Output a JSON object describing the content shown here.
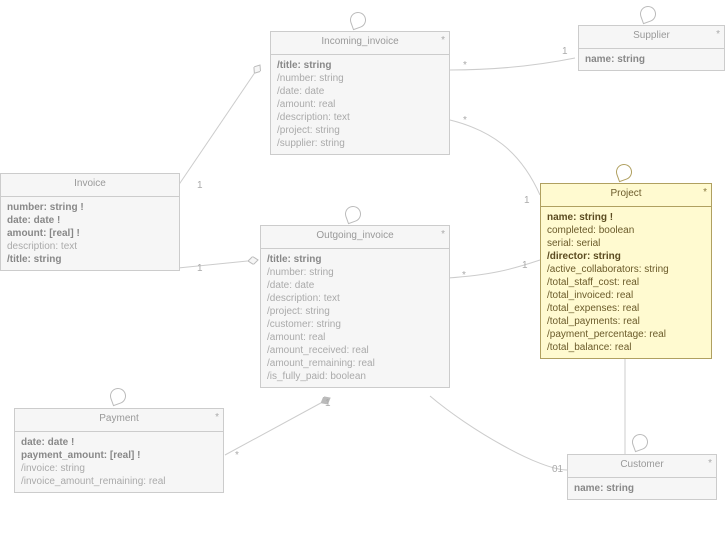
{
  "classes": {
    "invoice": {
      "title": "Invoice",
      "attrs": [
        {
          "t": "number: string !",
          "b": true
        },
        {
          "t": "date: date !",
          "b": true
        },
        {
          "t": "amount: [real] !",
          "b": true
        },
        {
          "t": "description: text",
          "b": false
        },
        {
          "t": "/title: string",
          "b": true
        }
      ]
    },
    "incoming": {
      "title": "Incoming_invoice",
      "mult": "*",
      "attrs": [
        {
          "t": "/title: string",
          "b": true
        },
        {
          "t": "/number: string",
          "b": false
        },
        {
          "t": "/date: date",
          "b": false
        },
        {
          "t": "/amount: real",
          "b": false
        },
        {
          "t": "/description: text",
          "b": false
        },
        {
          "t": "/project: string",
          "b": false
        },
        {
          "t": "/supplier: string",
          "b": false
        }
      ]
    },
    "outgoing": {
      "title": "Outgoing_invoice",
      "mult": "*",
      "attrs": [
        {
          "t": "/title: string",
          "b": true
        },
        {
          "t": "/number: string",
          "b": false
        },
        {
          "t": "/date: date",
          "b": false
        },
        {
          "t": "/description: text",
          "b": false
        },
        {
          "t": "/project: string",
          "b": false
        },
        {
          "t": "/customer: string",
          "b": false
        },
        {
          "t": "/amount: real",
          "b": false
        },
        {
          "t": "/amount_received: real",
          "b": false
        },
        {
          "t": "/amount_remaining: real",
          "b": false
        },
        {
          "t": "/is_fully_paid: boolean",
          "b": false
        }
      ]
    },
    "payment": {
      "title": "Payment",
      "mult": "*",
      "attrs": [
        {
          "t": "date: date !",
          "b": true
        },
        {
          "t": "payment_amount: [real] !",
          "b": true
        },
        {
          "t": "/invoice: string",
          "b": false
        },
        {
          "t": "/invoice_amount_remaining: real",
          "b": false
        }
      ]
    },
    "supplier": {
      "title": "Supplier",
      "mult": "*",
      "attrs": [
        {
          "t": "name: string",
          "b": true
        }
      ]
    },
    "project": {
      "title": "Project",
      "mult": "*",
      "attrs": [
        {
          "t": "name: string !",
          "b": true
        },
        {
          "t": "completed: boolean",
          "b": false
        },
        {
          "t": "serial: serial",
          "b": false
        },
        {
          "t": "/director: string",
          "b": true
        },
        {
          "t": "/active_collaborators: string",
          "b": false
        },
        {
          "t": "/total_staff_cost: real",
          "b": false
        },
        {
          "t": "/total_invoiced: real",
          "b": false
        },
        {
          "t": "/total_expenses: real",
          "b": false
        },
        {
          "t": "/total_payments: real",
          "b": false
        },
        {
          "t": "/payment_percentage: real",
          "b": false
        },
        {
          "t": "/total_balance: real",
          "b": false
        }
      ]
    },
    "customer": {
      "title": "Customer",
      "mult": "*",
      "attrs": [
        {
          "t": "name: string",
          "b": true
        }
      ]
    }
  },
  "cardinalities": {
    "c1": "1",
    "c2": "*",
    "c3": "01"
  }
}
